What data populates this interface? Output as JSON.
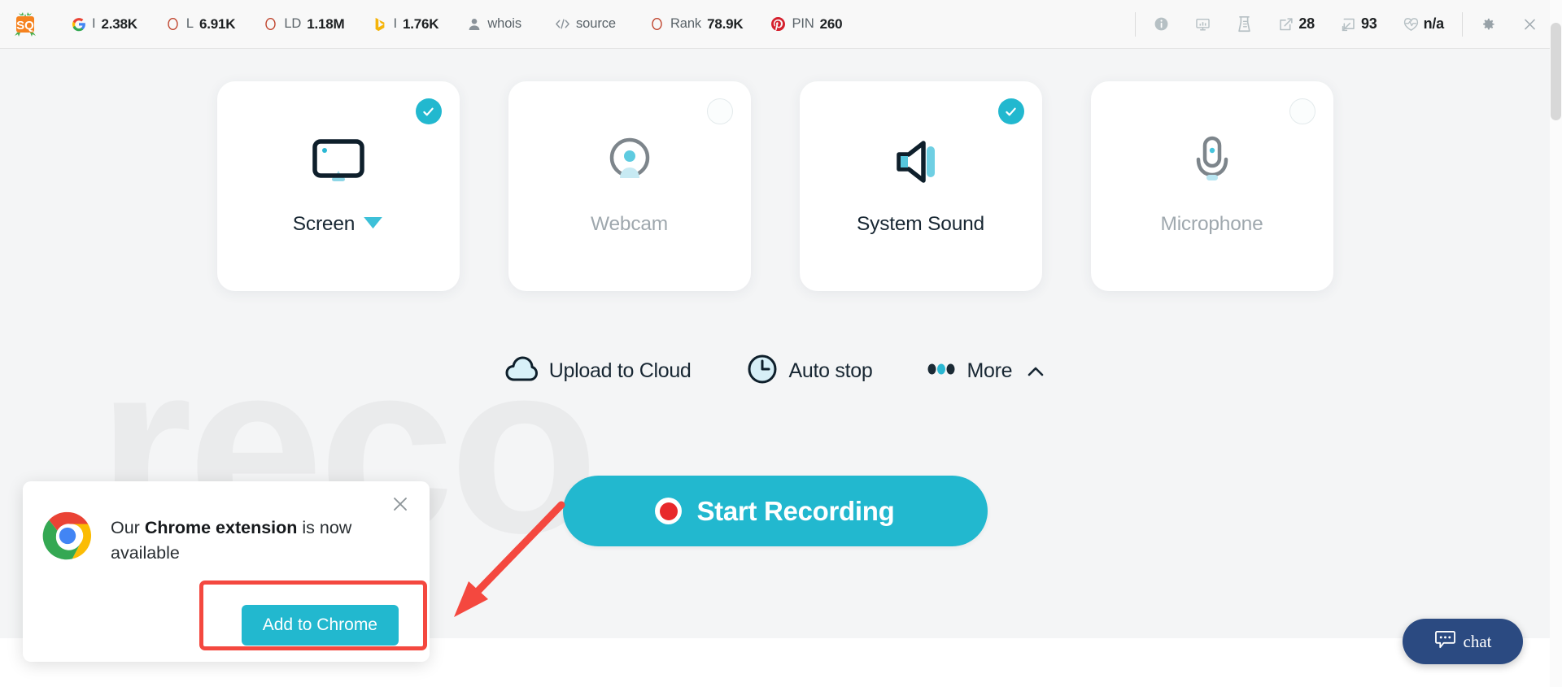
{
  "seo_toolbar": {
    "logo": "seoquake-logo",
    "metrics": [
      {
        "icon": "google-icon",
        "label": "I",
        "value": "2.38K",
        "name": "google-index"
      },
      {
        "icon": "circle-o-icon",
        "label": "L",
        "value": "6.91K",
        "name": "links"
      },
      {
        "icon": "circle-o-icon",
        "label": "LD",
        "value": "1.18M",
        "name": "linking-domains"
      },
      {
        "icon": "bing-icon",
        "label": "I",
        "value": "1.76K",
        "name": "bing-index"
      },
      {
        "icon": "person-icon",
        "label": "whois",
        "value": "",
        "name": "whois"
      },
      {
        "icon": "code-icon",
        "label": "source",
        "value": "",
        "name": "source"
      },
      {
        "icon": "circle-o-icon",
        "label": "Rank",
        "value": "78.9K",
        "name": "alexa-rank"
      },
      {
        "icon": "pinterest-icon",
        "label": "PIN",
        "value": "260",
        "name": "pinterest-pins"
      }
    ],
    "right_tools": [
      {
        "icon": "info-icon",
        "value": "",
        "name": "page-info"
      },
      {
        "icon": "dashboard-icon",
        "value": "",
        "name": "seo-dashboard"
      },
      {
        "icon": "beaker-icon",
        "value": "",
        "name": "seo-audit"
      },
      {
        "icon": "external-link-icon",
        "value": "28",
        "name": "external-links"
      },
      {
        "icon": "internal-link-icon",
        "value": "93",
        "name": "internal-links"
      },
      {
        "icon": "heartbeat-icon",
        "value": "n/a",
        "name": "page-health"
      }
    ],
    "settings_icon": "gear-icon",
    "close_icon": "close-icon"
  },
  "background": {
    "watermark_text": "reco"
  },
  "cards": [
    {
      "name": "screen",
      "label": "Screen",
      "icon": "monitor-icon",
      "selected": true,
      "has_dropdown": true
    },
    {
      "name": "webcam",
      "label": "Webcam",
      "icon": "webcam-icon",
      "selected": false,
      "has_dropdown": false
    },
    {
      "name": "system-sound",
      "label": "System Sound",
      "icon": "speaker-icon",
      "selected": true,
      "has_dropdown": false
    },
    {
      "name": "microphone",
      "label": "Microphone",
      "icon": "microphone-icon",
      "selected": false,
      "has_dropdown": false
    }
  ],
  "options": [
    {
      "name": "upload-to-cloud",
      "label": "Upload to Cloud",
      "icon": "cloud-icon"
    },
    {
      "name": "auto-stop",
      "label": "Auto stop",
      "icon": "clock-icon"
    },
    {
      "name": "more",
      "label": "More",
      "icon": "dots-icon",
      "chevron": "chevron-up-icon"
    }
  ],
  "start_button": {
    "label": "Start Recording",
    "icon": "record-dot-icon",
    "color": "#22b8cf"
  },
  "promo": {
    "icon": "chrome-logo-icon",
    "text_before": "Our ",
    "text_bold": "Chrome extension",
    "text_after": " is now available",
    "button_label": "Add to Chrome",
    "close_icon": "close-icon",
    "highlight_color": "#f4483f"
  },
  "chat_widget": {
    "label": "chat",
    "icon": "chat-bubble-icon",
    "color": "#2b4a81"
  }
}
